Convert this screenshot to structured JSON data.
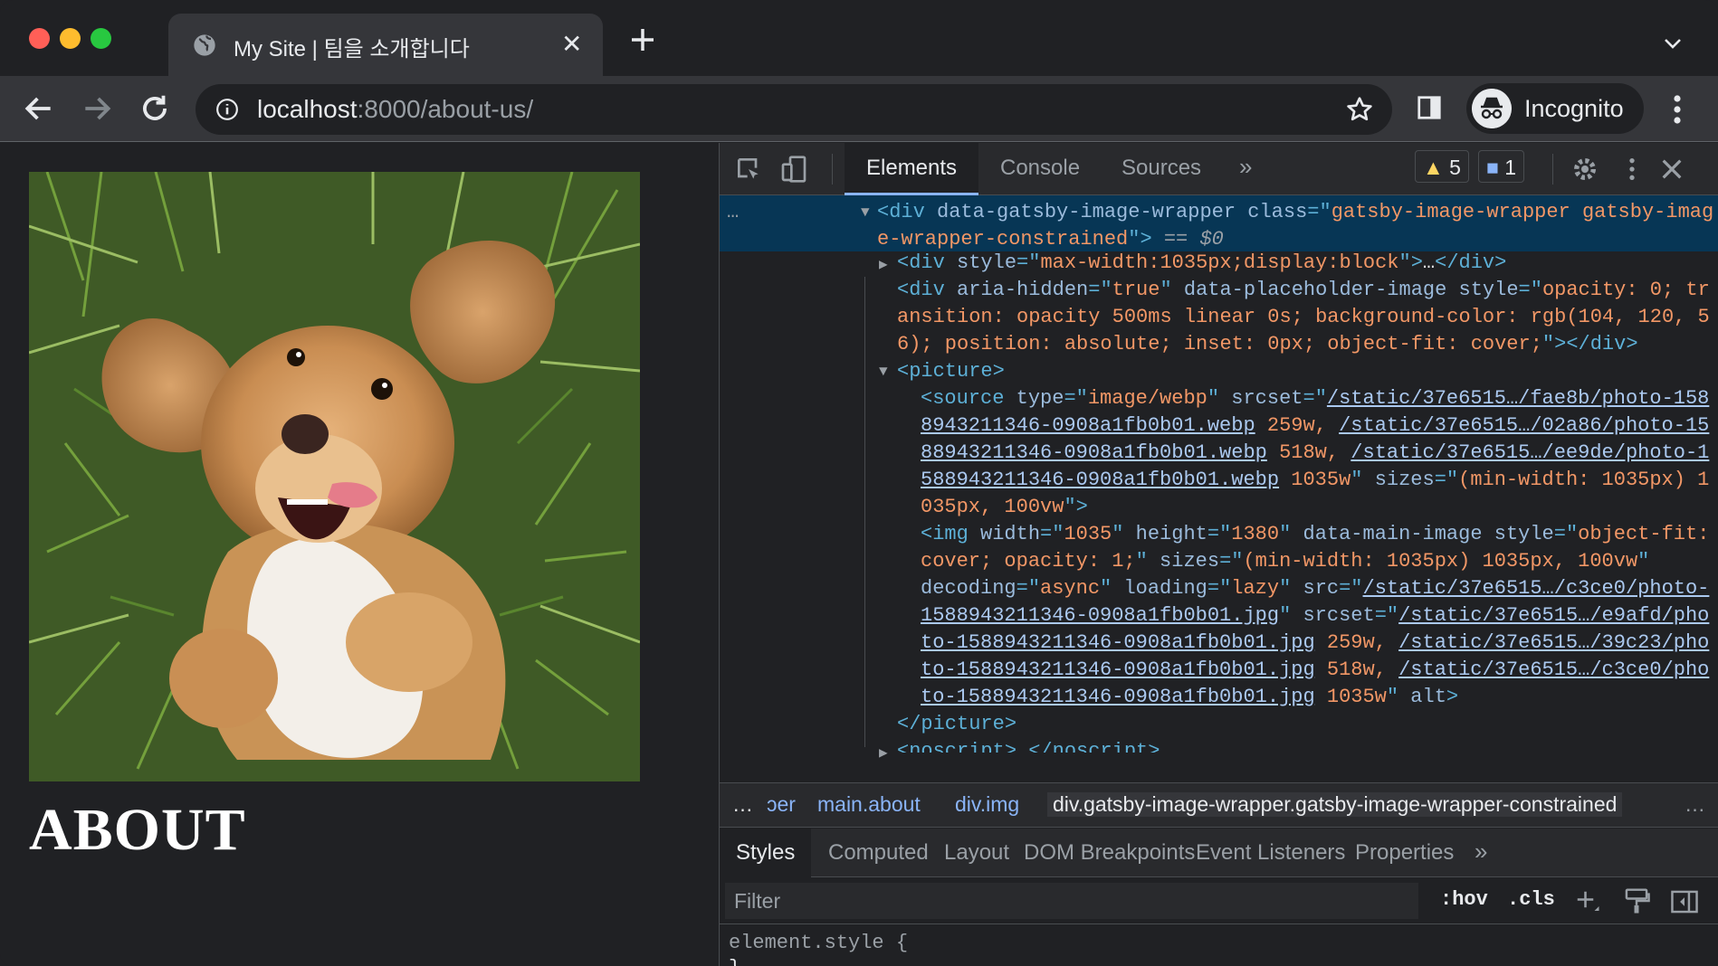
{
  "browser": {
    "tab_title": "My Site | 팀을 소개합니다",
    "tab_close": "✕",
    "url_host": "localhost",
    "url_rest": ":8000/about-us/",
    "profile_label": "Incognito"
  },
  "page": {
    "heading": "ABOUT",
    "photo_alt": "Puppy lying on its back in the grass"
  },
  "devtools": {
    "tabs": [
      "Elements",
      "Console",
      "Sources"
    ],
    "more_tabs": "»",
    "warnings_count": "5",
    "messages_count": "1",
    "breadcrumbs": [
      "…",
      "ɔer",
      "main.about",
      "div.img",
      "div.gatsby-image-wrapper.gatsby-image-wrapper-constrained",
      "…"
    ],
    "sub_tabs": [
      "Styles",
      "Computed",
      "Layout",
      "DOM Breakpoints",
      "Event Listeners",
      "Properties"
    ],
    "sub_more": "»",
    "filter_placeholder": "Filter",
    "hov_label": ":hov",
    "cls_label": ".cls",
    "element_style": "element.style {",
    "element_style_close": "}",
    "ellipsis": "…",
    "dollar_zero": "== $0"
  }
}
